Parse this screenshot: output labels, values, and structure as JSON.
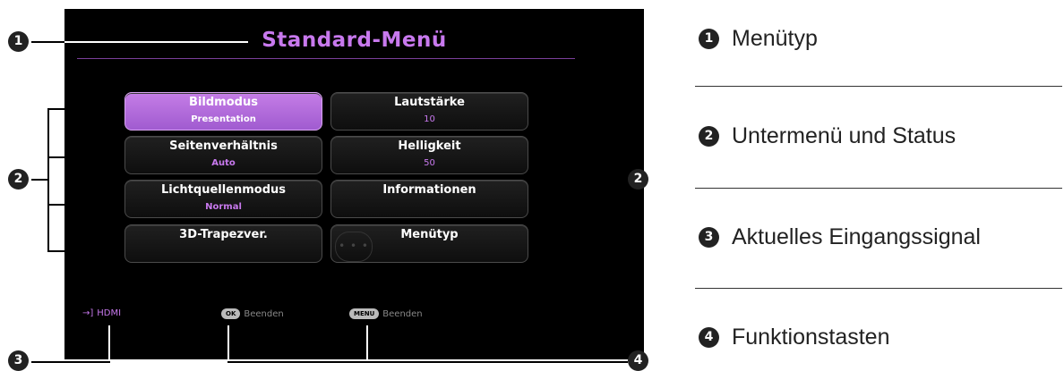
{
  "osd": {
    "title": "Standard-Menü",
    "items": [
      {
        "label": "Bildmodus",
        "value": "Presentation"
      },
      {
        "label": "Lautstärke",
        "value": "10"
      },
      {
        "label": "Seitenverhältnis",
        "value": "Auto"
      },
      {
        "label": "Helligkeit",
        "value": "50"
      },
      {
        "label": "Lichtquellenmodus",
        "value": "Normal"
      },
      {
        "label": "Informationen",
        "value": ""
      },
      {
        "label": "3D-Trapezver.",
        "value": ""
      },
      {
        "label": "Menütyp",
        "value": ""
      }
    ],
    "dots_glyph": "• • •",
    "footer": {
      "source_icon": "→]",
      "source": "HDMI",
      "ok_key": "OK",
      "ok_label": "Beenden",
      "menu_key": "MENU",
      "menu_label": "Beenden"
    }
  },
  "callouts": {
    "one": "1",
    "two": "2",
    "three": "3",
    "four": "4"
  },
  "legend": [
    {
      "num": "1",
      "text": "Menütyp"
    },
    {
      "num": "2",
      "text": "Untermenü und Status"
    },
    {
      "num": "3",
      "text": "Aktuelles Eingangssignal"
    },
    {
      "num": "4",
      "text": "Funktionstasten"
    }
  ],
  "colors": {
    "accent": "#c879ee",
    "active_bg": "#b46ddf"
  }
}
